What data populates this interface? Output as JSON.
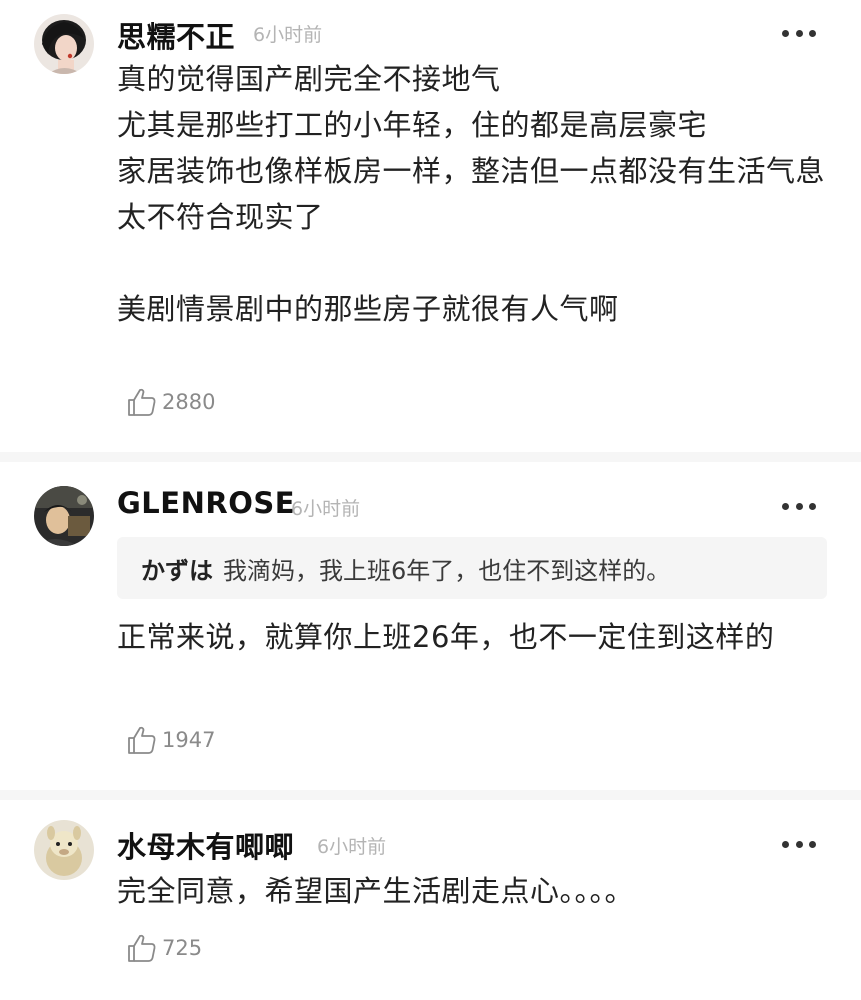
{
  "comments": [
    {
      "username": "思糯不正",
      "time": "6小时前",
      "text": "真的觉得国产剧完全不接地气\n尤其是那些打工的小年轻，住的都是高层豪宅\n家居装饰也像样板房一样，整洁但一点都没有生活气息\n太不符合现实了\n\n美剧情景剧中的那些房子就很有人气啊",
      "likes": "2880",
      "avatar_icon": "avatar-woman-black-hair"
    },
    {
      "username": "GLENROSE",
      "time": "6小时前",
      "quote_author": "かずは",
      "quote_text": "我滴妈，我上班6年了，也住不到这样的。",
      "text": "正常来说，就算你上班26年，也不一定住到这样的",
      "likes": "1947",
      "avatar_icon": "avatar-photo-dark"
    },
    {
      "username": "水母木有唧唧",
      "time": "6小时前",
      "text": "完全同意，希望国产生活剧走点心。。。。",
      "likes": "725",
      "avatar_icon": "avatar-alpaca"
    }
  ],
  "icons": {
    "more": "more-dots-icon",
    "like": "thumbs-up-icon"
  },
  "colors": {
    "username": "#111111",
    "timestamp": "#b4b4b4",
    "body": "#222222",
    "like_count": "#8a8a8a",
    "divider": "#f6f6f6",
    "quote_bg": "#f5f5f5"
  }
}
